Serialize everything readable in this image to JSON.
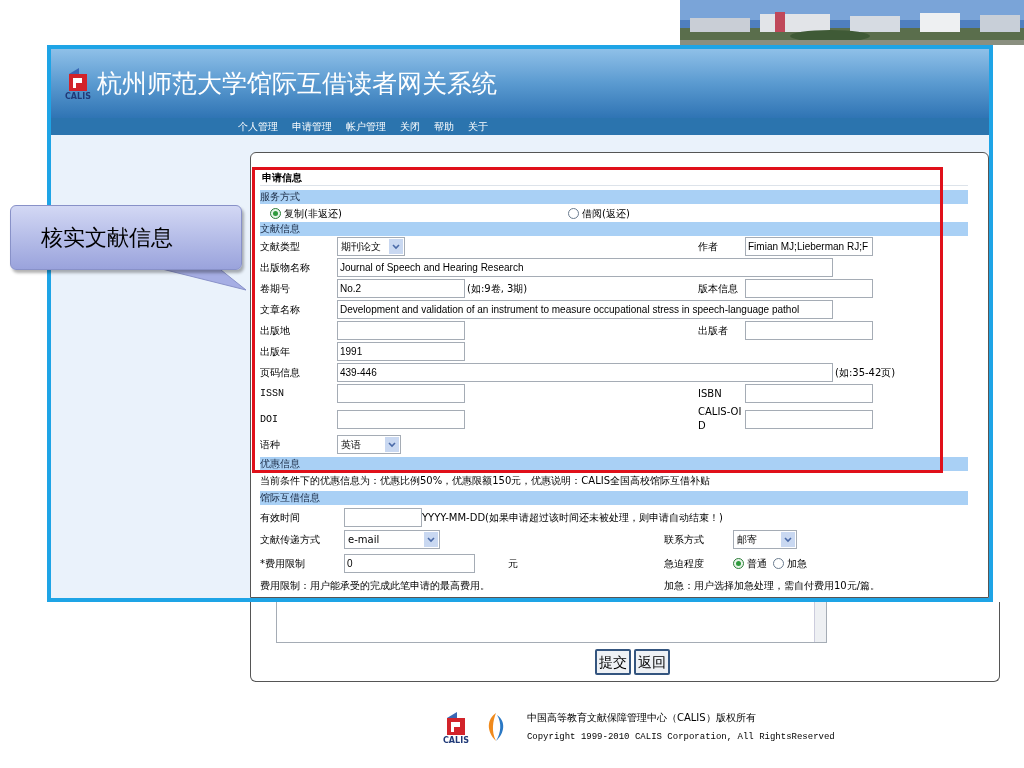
{
  "slide": {
    "callout": "核实文献信息"
  },
  "site": {
    "logo_label": "CALIS",
    "title": "杭州师范大学馆际互借读者网关系统",
    "nav": [
      "个人管理",
      "申请管理",
      "帐户管理",
      "关闭",
      "帮助",
      "关于"
    ]
  },
  "form": {
    "title": "申请信息",
    "service": {
      "heading": "服务方式",
      "options": [
        {
          "label": "复制(非返还)",
          "selected": true
        },
        {
          "label": "借阅(返还)",
          "selected": false
        }
      ]
    },
    "document": {
      "heading": "文献信息",
      "rows": [
        {
          "label": "文献类型",
          "field": {
            "kind": "select",
            "value": "期刊论文"
          },
          "right": {
            "label": "作者",
            "field": {
              "kind": "input",
              "value": "Fimian MJ;Lieberman RJ;F"
            }
          }
        },
        {
          "label": "出版物名称",
          "field": {
            "kind": "wide",
            "value": "Journal of Speech and Hearing Research"
          }
        },
        {
          "label": "卷期号",
          "field": {
            "kind": "input",
            "value": "No.2"
          },
          "hint": "(如:9卷, 3期)",
          "right": {
            "label": "版本信息",
            "field": {
              "kind": "input"
            }
          }
        },
        {
          "label": "文章名称",
          "field": {
            "kind": "wide",
            "value": "Development and validation of an instrument to measure occupational stress in speech-language pathol"
          }
        },
        {
          "label": "出版地",
          "field": {
            "kind": "input"
          },
          "right": {
            "label": "出版者",
            "field": {
              "kind": "input"
            }
          }
        },
        {
          "label": "出版年",
          "field": {
            "kind": "input",
            "value": "1991"
          }
        },
        {
          "label": "页码信息",
          "field": {
            "kind": "wide",
            "value": "439-446"
          },
          "hint": "(如:35-42页)"
        },
        {
          "label": "ISSN",
          "field": {
            "kind": "input"
          },
          "right": {
            "label": "ISBN",
            "field": {
              "kind": "input"
            }
          }
        },
        {
          "label": "DOI",
          "field": {
            "kind": "input"
          },
          "right": {
            "label": "CALIS-OID",
            "field": {
              "kind": "input"
            }
          }
        },
        {
          "label": "语种",
          "field": {
            "kind": "select",
            "value": "英语"
          }
        }
      ]
    },
    "discount": {
      "heading": "优惠信息",
      "text": "当前条件下的优惠信息为：优惠比例50%，优惠限额150元，优惠说明：CALIS全国高校馆际互借补贴"
    },
    "ill": {
      "heading": "馆际互借信息",
      "valid_time": {
        "label": "有效时间",
        "hint": "YYYY-MM-DD(如果申请超过该时间还未被处理，则申请自动结束！)"
      },
      "delivery": {
        "label": "文献传递方式",
        "value": "e-mail"
      },
      "contact": {
        "label": "联系方式",
        "value": "邮寄"
      },
      "fee": {
        "label": "*费用限制",
        "value": "0",
        "unit": "元"
      },
      "urgency": {
        "label": "急迫程度",
        "options": [
          {
            "label": "普通",
            "selected": true
          },
          {
            "label": "加急",
            "selected": false
          }
        ]
      },
      "fee_note": "费用限制：用户能承受的完成此笔申请的最高费用。",
      "urgent_note": "加急：用户选择加急处理，需自付费用10元/篇。"
    },
    "buttons": [
      "提交",
      "返回"
    ]
  },
  "footer": {
    "logo_label": "CALIS",
    "lines": [
      "中国高等教育文献保障管理中心（CALIS）版权所有",
      "Copyright 1999-2010 CALIS Corporation, All RightsReserved"
    ]
  }
}
